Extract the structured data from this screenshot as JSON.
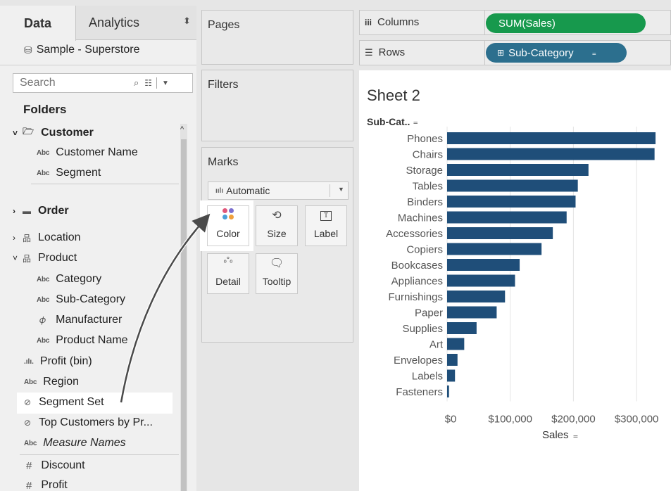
{
  "sidebar": {
    "tabs": {
      "data": "Data",
      "analytics": "Analytics"
    },
    "datasource": "Sample - Superstore",
    "search_placeholder": "Search",
    "folders_title": "Folders",
    "items": [
      {
        "icon": "folder",
        "label": "Customer",
        "bold": true
      },
      {
        "icon": "abc",
        "label": "Customer Name"
      },
      {
        "icon": "abc",
        "label": "Segment"
      },
      {
        "icon": "folder",
        "label": "Order",
        "bold": true
      },
      {
        "icon": "hierarchy",
        "label": "Location"
      },
      {
        "icon": "hierarchy",
        "label": "Product"
      },
      {
        "icon": "abc",
        "label": "Category"
      },
      {
        "icon": "abc",
        "label": "Sub-Category"
      },
      {
        "icon": "paperclip",
        "label": "Manufacturer"
      },
      {
        "icon": "abc",
        "label": "Product Name"
      },
      {
        "icon": "bin",
        "label": "Profit (bin)"
      },
      {
        "icon": "abc",
        "label": "Region"
      },
      {
        "icon": "set",
        "label": "Segment Set"
      },
      {
        "icon": "set",
        "label": "Top Customers by Pr..."
      },
      {
        "icon": "abc",
        "label": "Measure Names",
        "italic": true
      },
      {
        "icon": "hash",
        "label": "Discount"
      },
      {
        "icon": "hash",
        "label": "Profit"
      }
    ]
  },
  "cards": {
    "pages": "Pages",
    "filters": "Filters",
    "marks": "Marks",
    "mark_type": "Automatic",
    "buttons": {
      "color": "Color",
      "size": "Size",
      "label": "Label",
      "detail": "Detail",
      "tooltip": "Tooltip"
    }
  },
  "shelves": {
    "columns_label": "Columns",
    "rows_label": "Rows",
    "columns_pill": "SUM(Sales)",
    "rows_pill": "Sub-Category"
  },
  "colors": {
    "green_pill": "#17994d",
    "blue_pill": "#2c6f8e",
    "bar": "#1f4e79"
  },
  "sheet": {
    "title": "Sheet 2",
    "row_header": "Sub-Cat..",
    "axis_title": "Sales"
  },
  "chart_data": {
    "type": "bar",
    "orientation": "horizontal",
    "categories": [
      "Phones",
      "Chairs",
      "Storage",
      "Tables",
      "Binders",
      "Machines",
      "Accessories",
      "Copiers",
      "Bookcases",
      "Appliances",
      "Furnishings",
      "Paper",
      "Supplies",
      "Art",
      "Envelopes",
      "Labels",
      "Fasteners"
    ],
    "values": [
      330007,
      328449,
      223844,
      206966,
      203413,
      189239,
      167380,
      149528,
      114880,
      107532,
      91705,
      78479,
      46674,
      27119,
      16476,
      12486,
      3024
    ],
    "tick_labels": [
      "$0",
      "$100,000",
      "$200,000",
      "$300,000"
    ],
    "tick_values": [
      0,
      100000,
      200000,
      300000
    ],
    "xlim": [
      0,
      340000
    ],
    "xlabel": "Sales",
    "grid": true
  }
}
